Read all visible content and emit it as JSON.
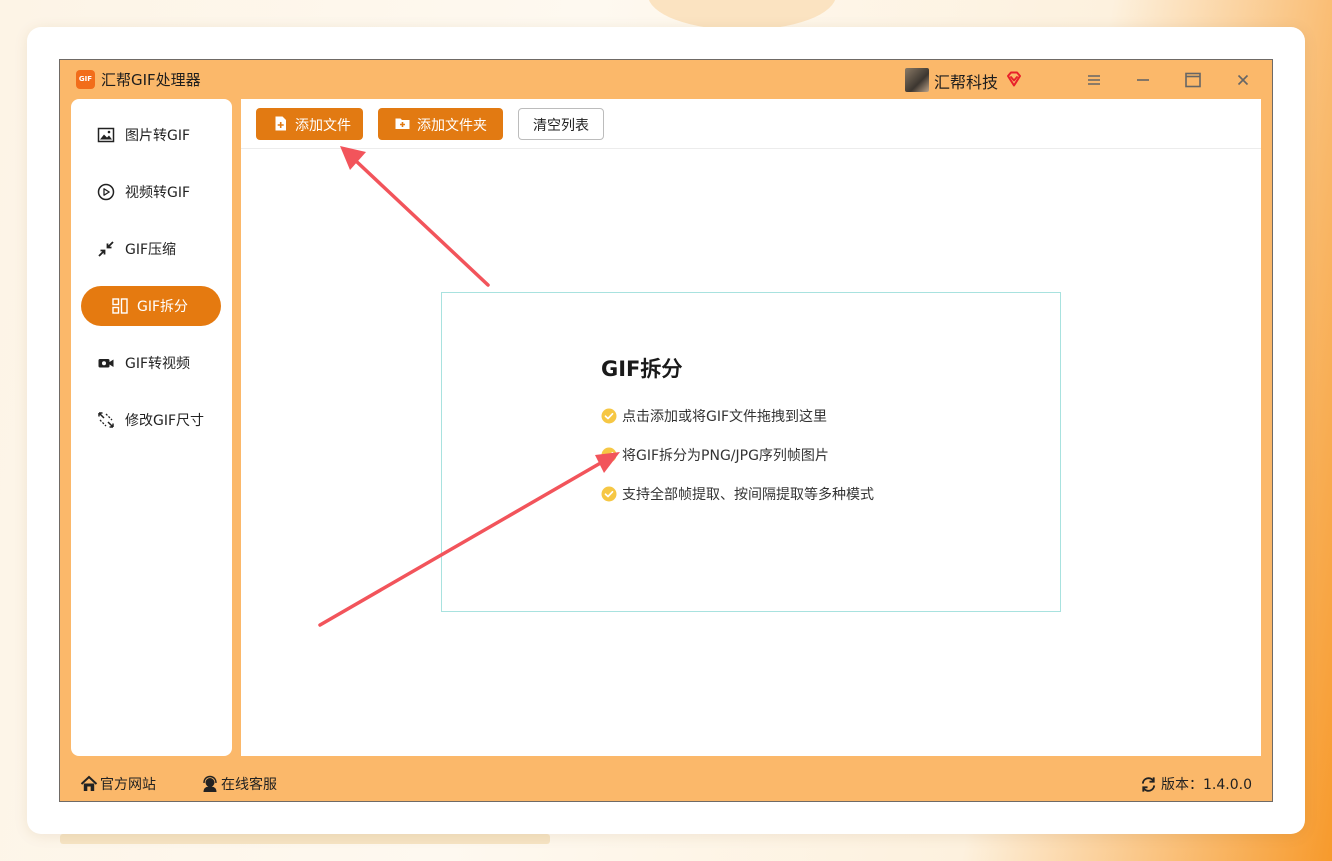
{
  "app": {
    "title": "汇帮GIF处理器",
    "logo_text": "GIF",
    "company": "汇帮科技"
  },
  "sidebar": {
    "items": [
      {
        "label": "图片转GIF",
        "icon": "image-icon",
        "active": false
      },
      {
        "label": "视频转GIF",
        "icon": "play-circle-icon",
        "active": false
      },
      {
        "label": "GIF压缩",
        "icon": "compress-arrows-icon",
        "active": false
      },
      {
        "label": "GIF拆分",
        "icon": "grid-split-icon",
        "active": true
      },
      {
        "label": "GIF转视频",
        "icon": "video-camera-icon",
        "active": false
      },
      {
        "label": "修改GIF尺寸",
        "icon": "resize-icon",
        "active": false
      }
    ]
  },
  "toolbar": {
    "add_file": "添加文件",
    "add_folder": "添加文件夹",
    "clear_list": "清空列表"
  },
  "dropzone": {
    "title": "GIF拆分",
    "items": [
      "点击添加或将GIF文件拖拽到这里",
      "将GIF拆分为PNG/JPG序列帧图片",
      "支持全部帧提取、按间隔提取等多种模式"
    ]
  },
  "footer": {
    "website": "官方网站",
    "service": "在线客服",
    "version": "版本：1.4.0.0"
  },
  "colors": {
    "accent": "#e27a12",
    "frame": "#fbb86a",
    "check": "#f6c744",
    "dropzone_border": "#a8e2df",
    "annotation_arrow": "#f2545b"
  }
}
